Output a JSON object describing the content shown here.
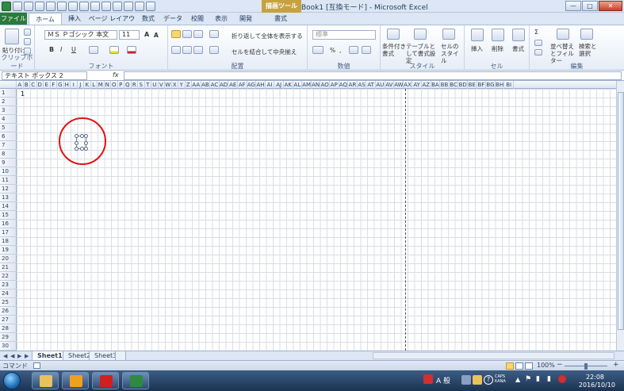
{
  "window": {
    "title": "Book1 [互換モード] - Microsoft Excel",
    "context_tab": "描画ツール",
    "controls": [
      "—",
      "□",
      "✕"
    ]
  },
  "tabs": [
    {
      "label": "ファイル"
    },
    {
      "label": "ホーム"
    },
    {
      "label": "挿入"
    },
    {
      "label": "ページ レイアウト"
    },
    {
      "label": "数式"
    },
    {
      "label": "データ"
    },
    {
      "label": "校閲"
    },
    {
      "label": "表示"
    },
    {
      "label": "開発"
    },
    {
      "label": "書式"
    }
  ],
  "ribbon": {
    "clipboard": {
      "paste": "貼り付け",
      "label": "クリップボード"
    },
    "font": {
      "name": "ＭＳ Ｐゴシック 本文",
      "size": "11",
      "label": "フォント",
      "grow": "A",
      "shrink": "A",
      "bold": "B",
      "italic": "I",
      "underline": "U"
    },
    "alignment": {
      "wrap": "折り返して全体を表示する",
      "merge": "セルを結合して中央揃え",
      "label": "配置"
    },
    "number": {
      "format": "標準",
      "label": "数値",
      "percent": "%",
      "comma": ","
    },
    "styles": {
      "conditional": "条件付き書式",
      "table": "テーブルとして書式設定",
      "cell": "セルのスタイル",
      "label": "スタイル"
    },
    "cells": {
      "insert": "挿入",
      "delete": "削除",
      "format": "書式",
      "label": "セル"
    },
    "editing": {
      "sort": "並べ替えとフィルター",
      "find": "検索と選択",
      "sum": "Σ",
      "label": "編集"
    }
  },
  "formula_bar": {
    "name_box": "テキスト ボックス 2",
    "fx": "fx",
    "value": ""
  },
  "columns": [
    "A",
    "B",
    "C",
    "D",
    "E",
    "F",
    "G",
    "H",
    "I",
    "J",
    "K",
    "L",
    "M",
    "N",
    "O",
    "P",
    "Q",
    "R",
    "S",
    "T",
    "U",
    "V",
    "W",
    "X",
    "Y",
    "Z",
    "AA",
    "AB",
    "AC",
    "AD",
    "AE",
    "AF",
    "AG",
    "AH",
    "AI",
    "AJ",
    "AK",
    "AL",
    "AM",
    "AN",
    "AO",
    "AP",
    "AQ",
    "AR",
    "AS",
    "AT",
    "AU",
    "AV",
    "AW",
    "AX",
    "AY",
    "AZ",
    "BA",
    "BB",
    "BC",
    "BD",
    "BE",
    "BF",
    "BG",
    "BH",
    "BI"
  ],
  "rows": [
    "1",
    "2",
    "3",
    "4",
    "5",
    "6",
    "7",
    "8",
    "9",
    "10",
    "11",
    "12",
    "13",
    "14",
    "15",
    "16",
    "17",
    "18",
    "19",
    "20",
    "21",
    "22",
    "23",
    "24",
    "25",
    "26",
    "27",
    "28",
    "29",
    "30"
  ],
  "cell_a1": "1",
  "sheets": [
    {
      "name": "Sheet1",
      "active": true
    },
    {
      "name": "Sheet2",
      "active": false
    },
    {
      "name": "Sheet3",
      "active": false
    }
  ],
  "status": {
    "mode": "コマンド",
    "zoom": "100%"
  },
  "taskbar": {
    "time": "22:08",
    "date": "2016/10/10",
    "ime": "A 般",
    "caps": "CAPS KANA"
  },
  "colors": {
    "file_tab": "#2a7b3c",
    "context_tab": "#c6a23f",
    "annotation": "#e01313"
  }
}
